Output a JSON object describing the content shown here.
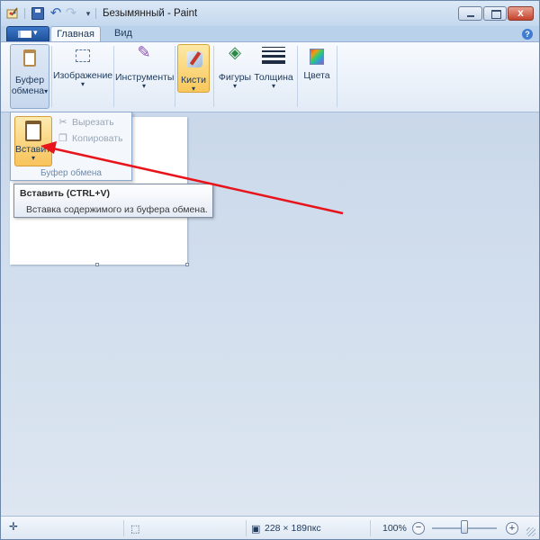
{
  "window": {
    "title": "Безымянный - Paint"
  },
  "quick_access": {
    "save_icon": "save-icon",
    "undo_glyph": "↶",
    "redo_glyph": "↷",
    "customize_glyph": "▾"
  },
  "window_controls": {
    "close_glyph": "x"
  },
  "tabs": [
    {
      "label": "Главная",
      "active": true
    },
    {
      "label": "Вид",
      "active": false
    }
  ],
  "help_glyph": "?",
  "ribbon": {
    "clipboard": {
      "label_line1": "Буфер",
      "label_line2": "обмена",
      "arrow": "▾"
    },
    "image": {
      "label": "Изображение",
      "arrow": "▾"
    },
    "tools": {
      "label": "Инструменты",
      "arrow": "▾"
    },
    "brushes": {
      "label": "Кисти",
      "arrow": "▾"
    },
    "shapes": {
      "label": "Фигуры",
      "arrow": "▾"
    },
    "size": {
      "label": "Толщина",
      "arrow": "▾"
    },
    "colors": {
      "label": "Цвета"
    }
  },
  "clipboard_popup": {
    "paste_label": "Вставить",
    "paste_arrow": "▾",
    "cut_label": "Вырезать",
    "copy_label": "Копировать",
    "group_label": "Буфер обмена",
    "cut_icon_glyph": "✂",
    "copy_icon_glyph": "❐"
  },
  "tooltip": {
    "title": "Вставить (CTRL+V)",
    "text": "Вставка содержимого из буфера обмена."
  },
  "statusbar": {
    "cursor_icon_glyph": "✛",
    "selection_icon_glyph": "⬚",
    "canvas_icon_glyph": "▣",
    "canvas_size": "228 × 189пкс",
    "zoom_level": "100%",
    "zoom_out_glyph": "−",
    "zoom_in_glyph": "+",
    "zoom_fraction": 0.5
  },
  "colors": {
    "annotation_arrow": "#e8141c",
    "accent": "#1e4f97",
    "highlight": "#f9c75a"
  }
}
